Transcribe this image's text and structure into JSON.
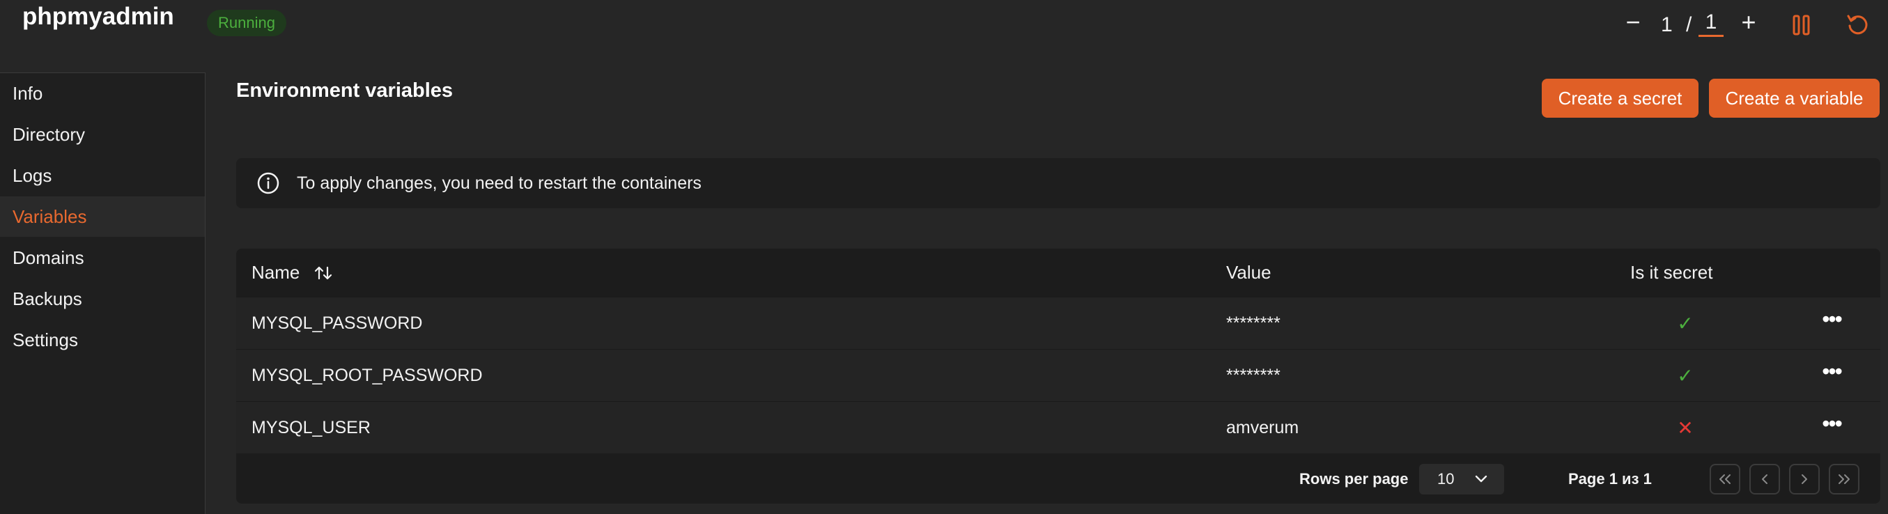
{
  "header": {
    "app_title": "phpmyadmin",
    "status": "Running",
    "scale": {
      "minus": "−",
      "current": "1",
      "separator": "/",
      "total": "1",
      "plus": "+"
    },
    "pause_icon": "pause-icon",
    "restart_icon": "restart-icon"
  },
  "sidebar": {
    "items": [
      {
        "label": "Info"
      },
      {
        "label": "Directory"
      },
      {
        "label": "Logs"
      },
      {
        "label": "Variables",
        "active": true
      },
      {
        "label": "Domains"
      },
      {
        "label": "Backups"
      },
      {
        "label": "Settings"
      }
    ]
  },
  "main": {
    "title": "Environment variables",
    "create_secret_label": "Create a secret",
    "create_variable_label": "Create a variable",
    "notice": "To apply changes, you need to restart the containers",
    "table": {
      "headers": {
        "name": "Name",
        "value": "Value",
        "secret": "Is it secret"
      },
      "rows": [
        {
          "name": "MYSQL_PASSWORD",
          "value": "********",
          "secret": true
        },
        {
          "name": "MYSQL_ROOT_PASSWORD",
          "value": "********",
          "secret": true
        },
        {
          "name": "MYSQL_USER",
          "value": "amverum",
          "secret": false
        }
      ]
    },
    "pagination": {
      "rows_per_page_label": "Rows per page",
      "rows_per_page_value": "10",
      "page_info": "Page 1 из 1"
    }
  },
  "colors": {
    "accent": "#e05f26",
    "status_green": "#4caf3e",
    "check_green": "#4caf3e",
    "cross_red": "#e53935"
  }
}
